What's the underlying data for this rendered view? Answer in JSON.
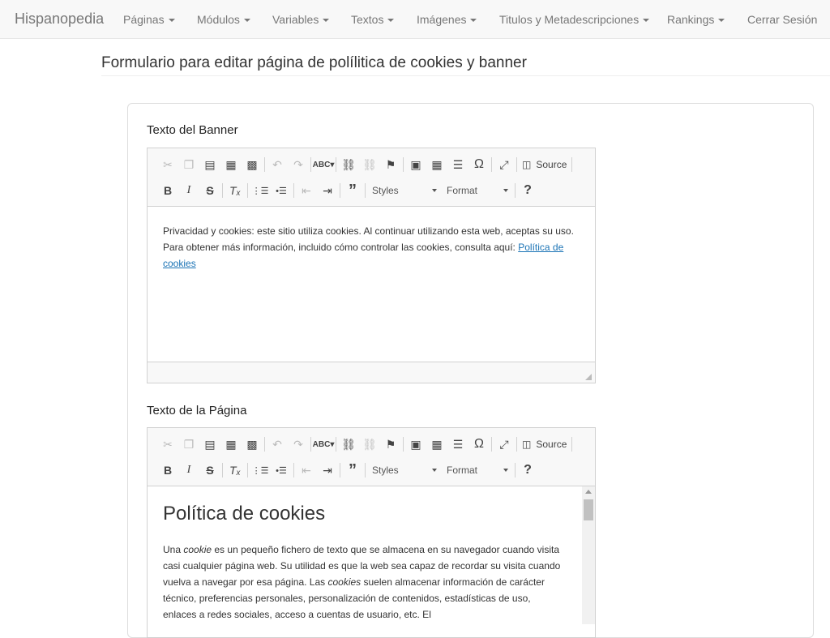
{
  "navbar": {
    "brand": "Hispanopedia",
    "items": [
      {
        "label": "Páginas"
      },
      {
        "label": "Módulos"
      },
      {
        "label": "Variables"
      },
      {
        "label": "Textos"
      },
      {
        "label": "Imágenes"
      },
      {
        "label": "Titulos y Metadescripciones"
      },
      {
        "label": "Rankings"
      }
    ],
    "logout": "Cerrar Sesión"
  },
  "page": {
    "title": "Formulario para editar página de polílitica de cookies y banner"
  },
  "form": {
    "banner_label": "Texto del Banner",
    "page_label": "Texto de la Página"
  },
  "editor_toolbar": {
    "source_label": "Source",
    "styles_label": "Styles",
    "format_label": "Format",
    "row1_icons": [
      "cut-icon",
      "copy-icon",
      "paste-icon",
      "paste-text-icon",
      "paste-word-icon",
      "undo-icon",
      "redo-icon",
      "spellcheck-icon",
      "link-icon",
      "unlink-icon",
      "anchor-icon",
      "image-icon",
      "table-icon",
      "horizontal-rule-icon",
      "special-char-icon",
      "maximize-icon",
      "source-icon"
    ],
    "row2_icons": [
      "bold-icon",
      "italic-icon",
      "strike-icon",
      "remove-format-icon",
      "numbered-list-icon",
      "bulleted-list-icon",
      "outdent-icon",
      "indent-icon",
      "blockquote-icon",
      "help-icon"
    ]
  },
  "banner_editor": {
    "line1": "Privacidad y cookies: este sitio utiliza cookies. Al continuar utilizando esta web, aceptas su uso.",
    "line2": "Para obtener más información, incluido cómo controlar las cookies, consulta aquí:",
    "link": "Política de cookies"
  },
  "page_editor": {
    "heading": "Política de cookies",
    "p_before_1": "Una ",
    "p_em_1": "cookie",
    "p_mid_1": " es un pequeño fichero de texto que se almacena en su navegador cuando visita casi cualquier página web. Su utilidad es que la web sea capaz de recordar su visita cuando vuelva a navegar por esa página. Las ",
    "p_em_2": "cookies",
    "p_after": " suelen almacenar información de carácter técnico, preferencias personales, personalización de contenidos, estadísticas de uso, enlaces a redes sociales, acceso a cuentas de usuario, etc. El"
  }
}
